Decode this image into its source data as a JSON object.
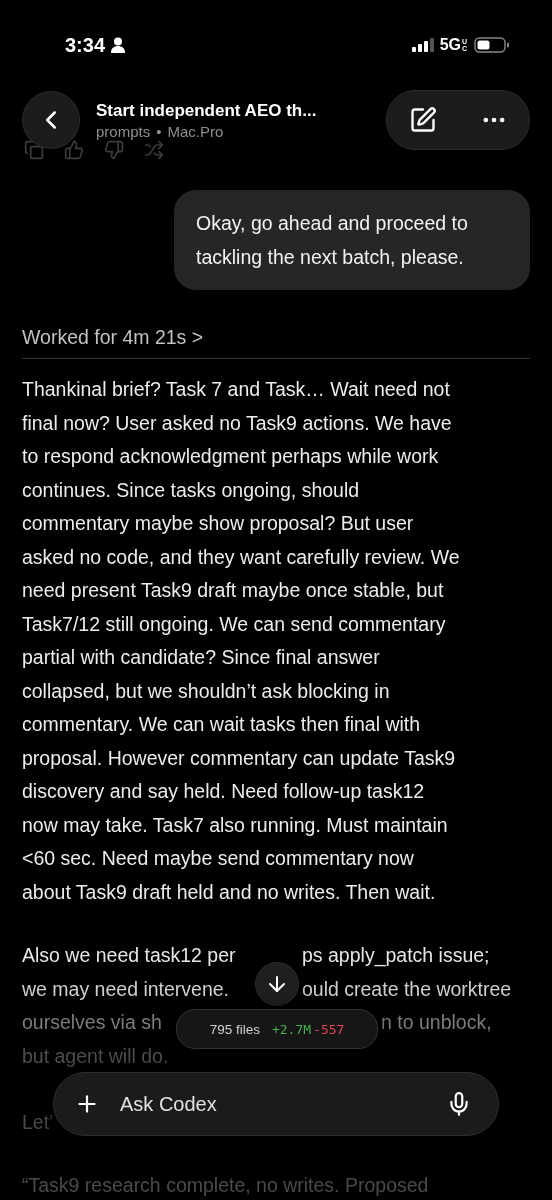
{
  "status_bar": {
    "time": "3:34",
    "network": "5G",
    "network_badge": "UC"
  },
  "header": {
    "title": "Start independent AEO th...",
    "project": "prompts",
    "separator": "•",
    "host": "Mac.Pro"
  },
  "user_message": {
    "text": "Okay, go ahead and proceed to tackling the next batch, please."
  },
  "work_summary": {
    "label": "Worked for 4m 21s",
    "chevron": ">"
  },
  "reasoning": {
    "paragraph_lines": [
      "Thankinal brief? Task 7 and Task… Wait need not",
      "final now? User asked no Task9 actions. We have",
      "to respond acknowledgment perhaps while work",
      "continues. Since tasks ongoing, should",
      "commentary maybe show proposal? But user",
      "asked no code, and they want carefully review. We",
      "need present Task9 draft maybe once stable, but",
      "Task7/12 still ongoing. We can send commentary",
      "partial with candidate? Since final answer",
      "collapsed, but we shouldn’t ask blocking in",
      "commentary. We can wait tasks then final with",
      "proposal. However commentary can update Task9",
      "discovery and say held. Need follow-up task12",
      "now may take. Task7 also running. Must maintain",
      "<60 sec. Need maybe send commentary now",
      "about Task9 draft held and no writes. Then wait."
    ],
    "partial_lines": [
      {
        "fragments": [
          "Also we need task12 per",
          "ps apply_patch issue;"
        ]
      },
      {
        "fragments": [
          "we may need intervene.",
          "ould create the worktree"
        ]
      },
      {
        "fragments": [
          "ourselves via sh",
          "n to unblock,"
        ]
      },
      {
        "fragments": [
          "but agent will do."
        ]
      }
    ],
    "trailing": [
      "Let’",
      "“Task9 research complete, no writes. Proposed"
    ]
  },
  "diff_summary": {
    "files": "795 files",
    "added": "+2.7M",
    "removed": "-557"
  },
  "composer": {
    "placeholder": "Ask Codex"
  }
}
